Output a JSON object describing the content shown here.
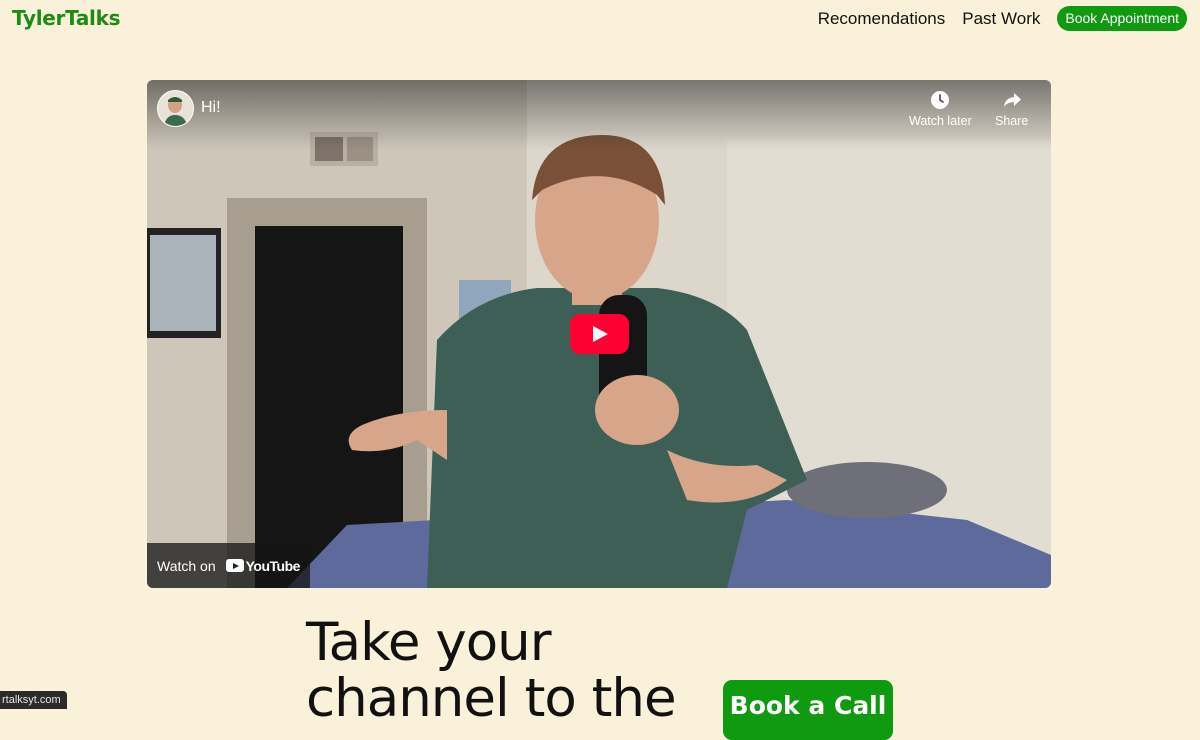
{
  "header": {
    "logo": "TylerTalks",
    "nav": [
      {
        "label": "Recomendations"
      },
      {
        "label": "Past Work"
      }
    ],
    "cta": "Book Appointment",
    "brand_color": "#0f9a10"
  },
  "video": {
    "title": "Hi!",
    "watch_later": "Watch later",
    "share": "Share",
    "watch_on": "Watch on",
    "youtube": "YouTube",
    "play_icon": "play-icon"
  },
  "hero": {
    "line1": "Take your",
    "line2": "channel to the",
    "cta": "Book a Call"
  },
  "status_url": "rtalksyt.com"
}
